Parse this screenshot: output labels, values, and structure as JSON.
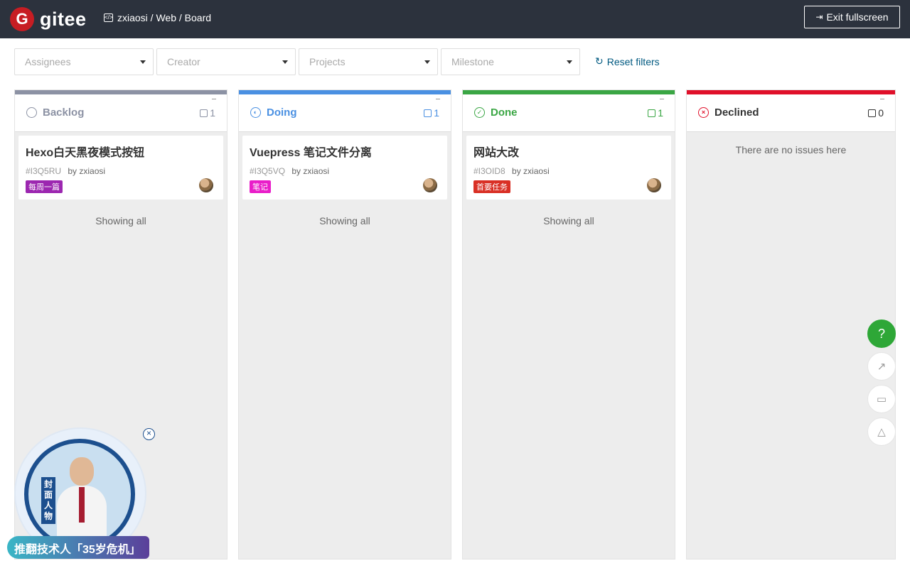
{
  "topbar": {
    "logo_mark": "G",
    "logo_text": "gitee",
    "breadcrumb": "zxiaosi / Web / Board",
    "exit_label": "Exit fullscreen"
  },
  "filters": {
    "assignees": "Assignees",
    "creator": "Creator",
    "projects": "Projects",
    "milestone": "Milestone",
    "reset_label": "Reset filters"
  },
  "columns": [
    {
      "title": "Backlog",
      "count": "1",
      "color": "#8c92a4",
      "card": {
        "title": "Hexo白天黑夜模式按钮",
        "id": "#I3Q5RU",
        "by": "by zxiaosi",
        "tag": "每周一篇",
        "tag_color": "#9c27b0"
      },
      "footer": "Showing all"
    },
    {
      "title": "Doing",
      "count": "1",
      "color": "#4a90e2",
      "card": {
        "title": "Vuepress 笔记文件分离",
        "id": "#I3Q5VQ",
        "by": "by zxiaosi",
        "tag": "笔记",
        "tag_color": "#e91ec9"
      },
      "footer": "Showing all"
    },
    {
      "title": "Done",
      "count": "1",
      "color": "#3aa644",
      "card": {
        "title": "网站大改",
        "id": "#I3OID8",
        "by": "by zxiaosi",
        "tag": "首要任务",
        "tag_color": "#d93025"
      },
      "footer": "Showing all"
    },
    {
      "title": "Declined",
      "count": "0",
      "color": "#e0102a",
      "empty_text": "There are no issues here"
    }
  ],
  "fabs": {
    "help": "?"
  },
  "ad": {
    "vertical_label": "封面人物",
    "banner": "推翻技术人「35岁危机」"
  }
}
